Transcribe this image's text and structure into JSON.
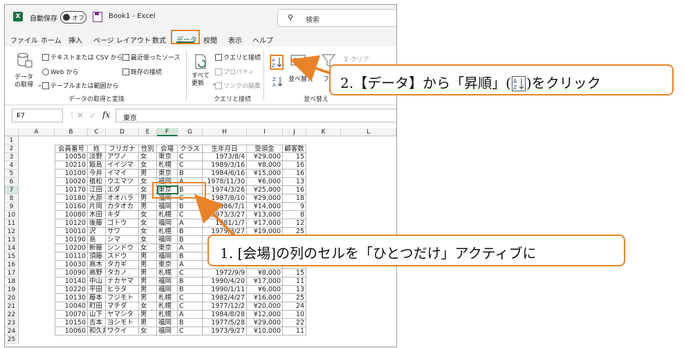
{
  "titlebar": {
    "app_icon": "excel-icon",
    "autosave_label": "自動保存",
    "autosave_state": "オフ",
    "doc_title": "Book1  -  Excel",
    "search_placeholder": "検索"
  },
  "menu": {
    "items": [
      "ファイル",
      "ホーム",
      "挿入",
      "ページ レイアウト",
      "数式",
      "データ",
      "校閲",
      "表示",
      "ヘルプ"
    ],
    "active": "データ"
  },
  "ribbon": {
    "get_data": "データの取得",
    "text_csv": "テキストまたは CSV から",
    "from_web": "Web から",
    "from_table": "テーブルまたは範囲から",
    "recent_sources": "最近使ったソース",
    "existing_conn": "既存の接続",
    "group_get": "データの取得と変換",
    "refresh_all": "すべて更新",
    "queries_conn": "クエリと接続",
    "properties": "プロパティ",
    "edit_links": "リンクの編集",
    "group_queries": "クエリと接続",
    "sort": "並べ替え",
    "filter": "フィ",
    "clear": "クリア",
    "group_sort": "並べ替え"
  },
  "formula_bar": {
    "name_box": "F7",
    "value": "東京"
  },
  "sheet": {
    "columns": [
      "A",
      "B",
      "C",
      "D",
      "E",
      "F",
      "G",
      "H",
      "I",
      "J",
      "K",
      "L"
    ],
    "rows": [
      "1",
      "2",
      "3",
      "4",
      "5",
      "6",
      "7",
      "8",
      "9",
      "10",
      "11",
      "12",
      "13",
      "14",
      "15",
      "16",
      "17",
      "18",
      "19",
      "20",
      "21",
      "22",
      "23",
      "24",
      "25"
    ],
    "headers": [
      "会員番号",
      "姓",
      "フリガナ",
      "性別",
      "会場",
      "クラス",
      "生年月日",
      "受領金",
      "顧客数"
    ],
    "data": [
      [
        "10050",
        "淡野",
        "アワノ",
        "女",
        "東京",
        "C",
        "1973/8/4",
        "¥29,000",
        "15"
      ],
      [
        "10210",
        "飯島",
        "イイジマ",
        "女",
        "札幌",
        "C",
        "1989/3/16",
        "¥8,000",
        "16"
      ],
      [
        "10100",
        "今井",
        "イマイ",
        "男",
        "東京",
        "B",
        "1984/6/16",
        "¥15,000",
        "16"
      ],
      [
        "10020",
        "植松",
        "ウエマツ",
        "女",
        "福岡",
        "A",
        "1978/11/30",
        "¥6,000",
        "13"
      ],
      [
        "10170",
        "江田",
        "エダ",
        "女",
        "東京",
        "B",
        "1974/3/26",
        "¥25,000",
        "16"
      ],
      [
        "10180",
        "大原",
        "オオハラ",
        "男",
        "福岡",
        "C",
        "1987/8/10",
        "¥29,000",
        "18"
      ],
      [
        "10160",
        "片岡",
        "カタオカ",
        "男",
        "福岡",
        "B",
        "1986/7/1",
        "¥14,000",
        "9"
      ],
      [
        "10080",
        "木田",
        "キダ",
        "女",
        "札幌",
        "C",
        "1973/3/27",
        "¥13,000",
        "8"
      ],
      [
        "10120",
        "後藤",
        "ゴトウ",
        "女",
        "福岡",
        "A",
        "1981/1/7",
        "¥17,000",
        "12"
      ],
      [
        "10010",
        "沢",
        "サワ",
        "女",
        "札幌",
        "B",
        "1979/3/27",
        "¥19,000",
        "25"
      ],
      [
        "10190",
        "島",
        "シマ",
        "女",
        "福岡",
        "B",
        "",
        "",
        ""
      ],
      [
        "10200",
        "新藤",
        "シンドウ",
        "女",
        "東京",
        "A",
        "",
        "",
        ""
      ],
      [
        "10110",
        "須藤",
        "スドウ",
        "男",
        "福岡",
        "B",
        "",
        "",
        ""
      ],
      [
        "10030",
        "高木",
        "タカギ",
        "男",
        "東京",
        "A",
        "",
        "",
        ""
      ],
      [
        "10090",
        "高野",
        "タカノ",
        "男",
        "札幌",
        "C",
        "1972/9/9",
        "¥8,000",
        "15"
      ],
      [
        "10140",
        "中山",
        "ナカヤマ",
        "男",
        "福岡",
        "B",
        "1990/4/20",
        "¥17,000",
        "11"
      ],
      [
        "10220",
        "平田",
        "ヒラタ",
        "男",
        "福岡",
        "B",
        "1990/1/11",
        "¥6,000",
        "13"
      ],
      [
        "10130",
        "藤本",
        "フジモト",
        "男",
        "札幌",
        "C",
        "1982/4/27",
        "¥16,000",
        "25"
      ],
      [
        "10040",
        "町田",
        "マチダ",
        "女",
        "札幌",
        "C",
        "1977/12/2",
        "¥20,000",
        "24"
      ],
      [
        "10070",
        "山下",
        "ヤマシタ",
        "男",
        "札幌",
        "A",
        "1984/8/28",
        "¥12,000",
        "10"
      ],
      [
        "10150",
        "吉本",
        "ヨシモト",
        "男",
        "福岡",
        "B",
        "1977/5/28",
        "¥29,000",
        "22"
      ],
      [
        "10060",
        "和久井",
        "ワクイ",
        "女",
        "福岡",
        "C",
        "1973/9/27",
        "¥10,000",
        "11"
      ]
    ]
  },
  "annotations": {
    "callout1": "1. [会場]の列のセルを「ひとつだけ」アクティブに",
    "callout2_pre": "2.【データ】から「昇順」(",
    "callout2_post": ")をクリック",
    "accent_color": "#e8832a"
  }
}
